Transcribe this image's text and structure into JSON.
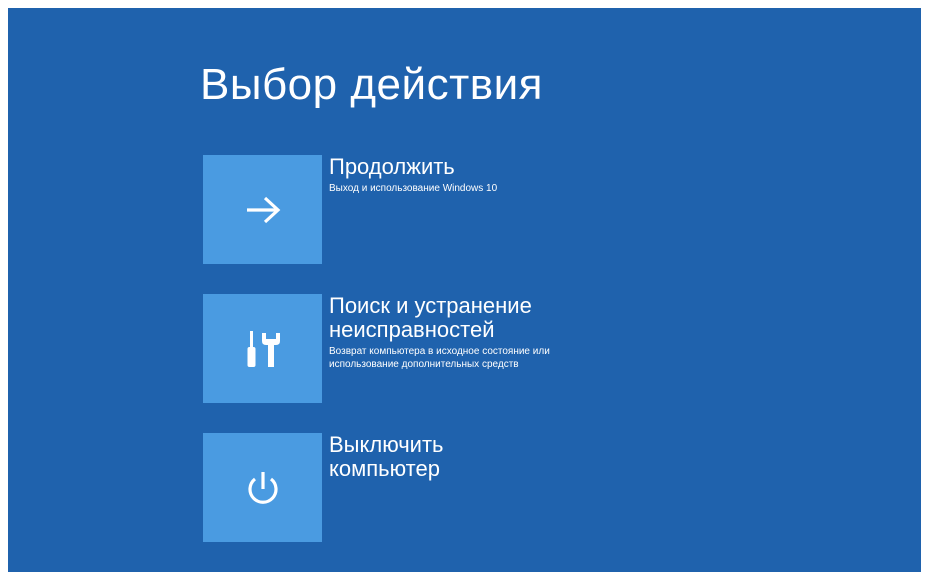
{
  "screen": {
    "title": "Выбор действия",
    "background_color": "#1f62ad",
    "tile_color": "#4a9be1"
  },
  "options": [
    {
      "icon": "arrow-right-icon",
      "title": "Продолжить",
      "description": "Выход и использование Windows 10"
    },
    {
      "icon": "tools-icon",
      "title": "Поиск и устранение\nнеисправностей",
      "description": "Возврат компьютера в исходное состояние или использование дополнительных средств"
    },
    {
      "icon": "power-icon",
      "title": "Выключить\nкомпьютер",
      "description": ""
    }
  ]
}
